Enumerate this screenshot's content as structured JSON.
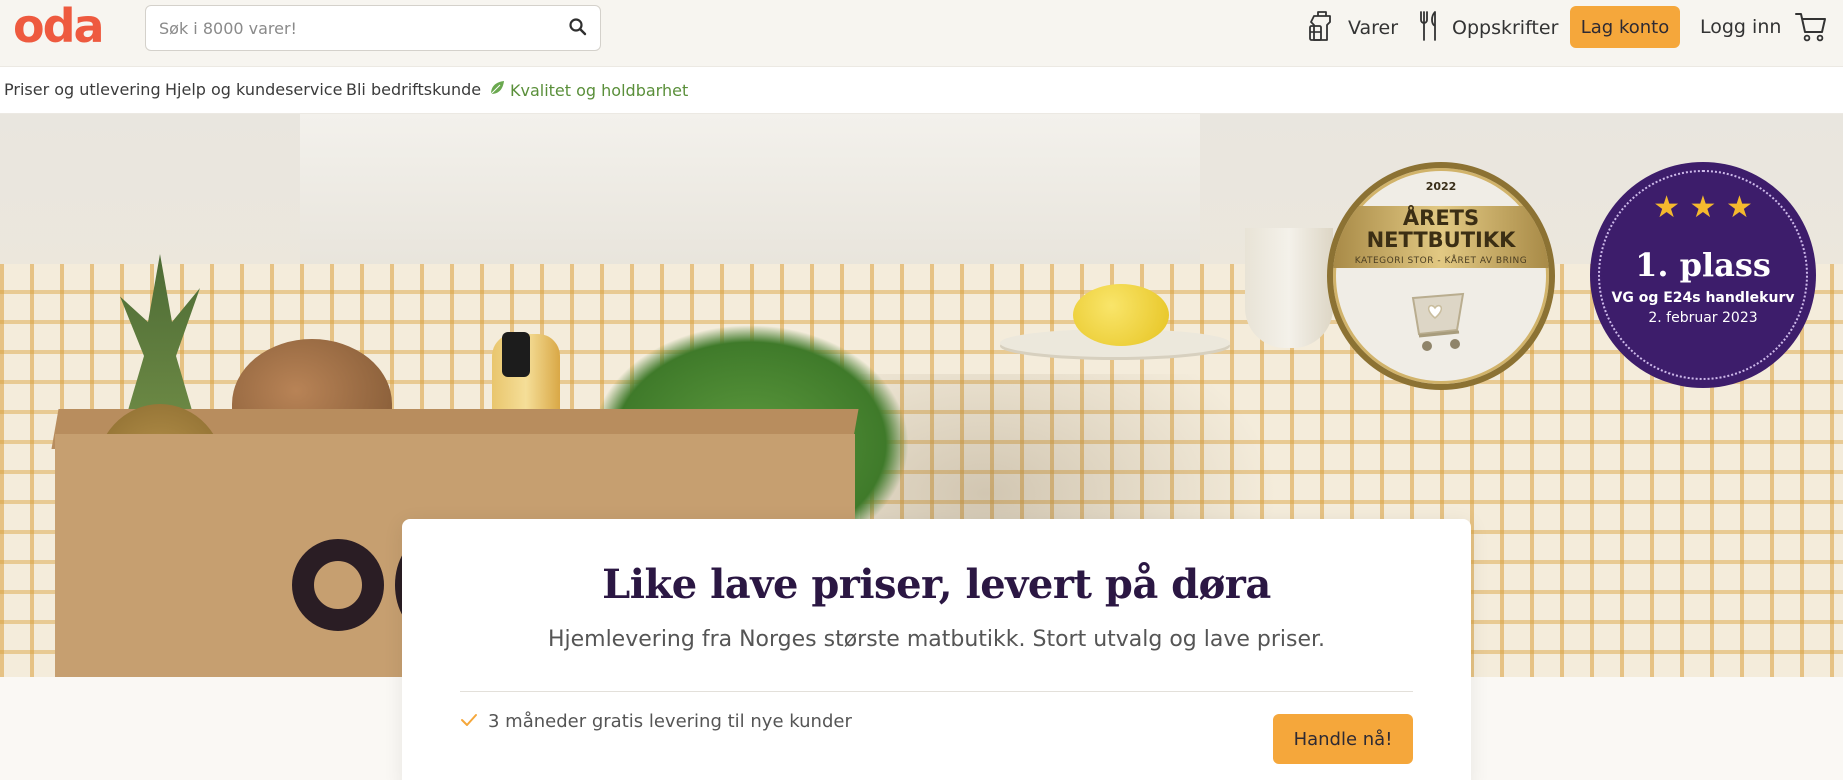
{
  "header": {
    "logo_text": "oda",
    "search": {
      "placeholder": "Søk i 8000 varer!"
    },
    "nav": {
      "varer_label": "Varer",
      "oppskrifter_label": "Oppskrifter",
      "lag_konto_label": "Lag konto",
      "logg_inn_label": "Logg inn"
    },
    "icons": [
      "search-icon",
      "grocery-bag-icon",
      "cutlery-icon",
      "cart-icon"
    ]
  },
  "subnav": {
    "items": [
      {
        "label": "Priser og utlevering"
      },
      {
        "label": "Hjelp og kundeservice"
      },
      {
        "label": "Bli bedriftskunde"
      },
      {
        "label": "Kvalitet og holdbarhet",
        "icon": "leaf-icon"
      }
    ]
  },
  "hero": {
    "badge_gold": {
      "year": "2022",
      "title_line1": "ÅRETS",
      "title_line2": "NETTBUTIKK",
      "subtitle": "KATEGORI STOR  -  KÅRET AV BRING"
    },
    "badge_purple": {
      "stars": "★ ★ ★",
      "title": "1. plass",
      "line1": "VG og E24s handlekurv",
      "line2": "2. februar 2023"
    }
  },
  "card": {
    "title": "Like lave priser, levert på døra",
    "subtitle": "Hjemlevering fra Norges største matbutikk. Stort utvalg og lave priser.",
    "perk": "3 måneder gratis levering til nye kunder",
    "cta_label": "Handle nå!"
  },
  "colors": {
    "brand": "#ee5a3f",
    "accent": "#f5a73b",
    "heading": "#2b1743",
    "quality_link": "#5a8f3a",
    "badge_purple": "#3d1d6b"
  }
}
